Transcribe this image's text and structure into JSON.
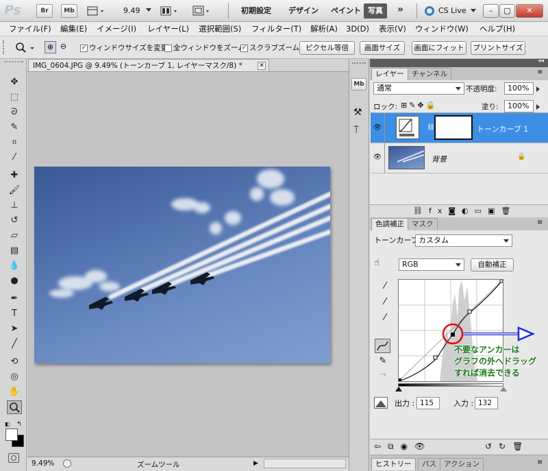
{
  "app": {
    "logo": "Ps",
    "br": "Br",
    "mb": "Mb",
    "zoom": "9.49"
  },
  "workspaces": [
    {
      "label": "初期設定"
    },
    {
      "label": "デザイン"
    },
    {
      "label": "ペイント"
    },
    {
      "label": "写真"
    }
  ],
  "more": "»",
  "cslive": "CS Live",
  "menu": [
    "ファイル(F)",
    "編集(E)",
    "イメージ(I)",
    "レイヤー(L)",
    "選択範囲(S)",
    "フィルター(T)",
    "解析(A)",
    "3D(D)",
    "表示(V)",
    "ウィンドウ(W)",
    "ヘルプ(H)"
  ],
  "options": {
    "resize": "ウィンドウサイズを変更",
    "allwin": "全ウィンドウをズーム",
    "scrubby": "スクラブズーム",
    "actual": "ピクセル等倍",
    "fitscreen": "画面サイズ",
    "fillscreen": "画面にフィット",
    "print": "プリントサイズ"
  },
  "document": {
    "tab": "IMG_0604.JPG @ 9.49% (トーンカーブ 1, レイヤーマスク/8) *",
    "zoom": "9.49%",
    "tool": "ズームツール"
  },
  "layers_panel": {
    "tab_layers": "レイヤー",
    "tab_channels": "チャンネル",
    "blend": "通常",
    "opacity_label": "不透明度:",
    "opacity": "100%",
    "lock_label": "ロック:",
    "fill_label": "塗り:",
    "fill": "100%",
    "layer1": "トーンカーブ 1",
    "layer2": "背景"
  },
  "adjust_panel": {
    "tab_adjust": "色調補正",
    "tab_mask": "マスク",
    "type_label": "トーンカーブ",
    "preset": "カスタム",
    "channel": "RGB",
    "auto": "自動補正",
    "output_label": "出力 :",
    "output": "115",
    "input_label": "入力 :",
    "input": "132"
  },
  "annotation": {
    "line1": "不要なアンカーは",
    "line2": "グラフの外へドラッグ",
    "line3": "すれば消去できる",
    "color": "#1a7a1a"
  },
  "bottom_tabs": [
    "ヒストリー",
    "パス",
    "アクション"
  ]
}
